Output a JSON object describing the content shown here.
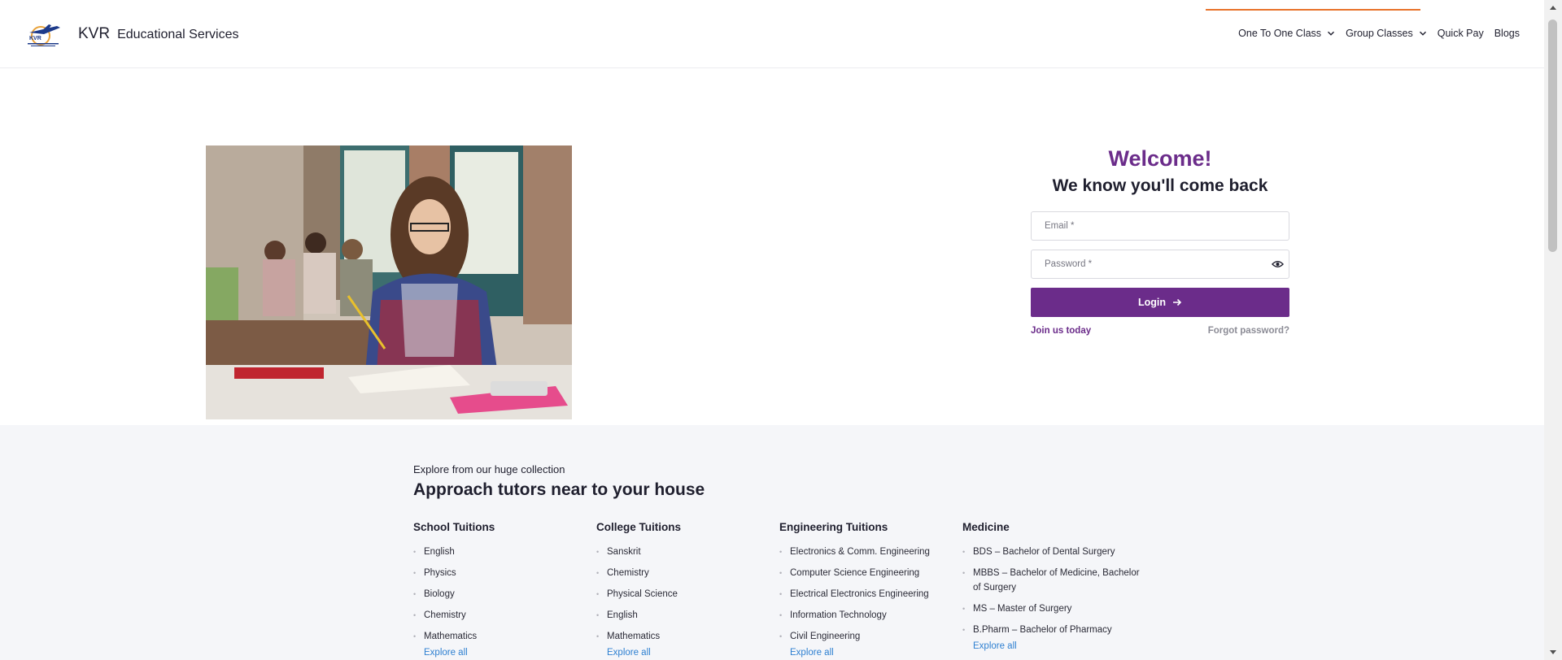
{
  "header": {
    "brand_name": "KVR",
    "brand_sub": "Educational Services",
    "nav": [
      {
        "label": "One To One Class",
        "dropdown": true
      },
      {
        "label": "Group Classes",
        "dropdown": true
      },
      {
        "label": "Quick Pay",
        "dropdown": false
      },
      {
        "label": "Blogs",
        "dropdown": false
      }
    ]
  },
  "login": {
    "welcome": "Welcome!",
    "tagline": "We know you'll come back",
    "email_placeholder": "Email *",
    "password_placeholder": "Password *",
    "login_label": "Login",
    "join_label": "Join us today",
    "forgot_label": "Forgot password?"
  },
  "explore": {
    "subtitle": "Explore from our huge collection",
    "title": "Approach tutors near to your house",
    "explore_all": "Explore all",
    "columns": [
      {
        "title": "School Tuitions",
        "items": [
          "English",
          "Physics",
          "Biology",
          "Chemistry",
          "Mathematics"
        ]
      },
      {
        "title": "College Tuitions",
        "items": [
          "Sanskrit",
          "Chemistry",
          "Physical Science",
          "English",
          "Mathematics"
        ]
      },
      {
        "title": "Engineering Tuitions",
        "items": [
          "Electronics & Comm. Engineering",
          "Computer Science Engineering",
          "Electrical Electronics Engineering",
          "Information Technology",
          "Civil Engineering"
        ]
      },
      {
        "title": "Medicine",
        "items": [
          "BDS – Bachelor of Dental Surgery",
          "MBBS – Bachelor of Medicine, Bachelor of Surgery",
          "MS – Master of Surgery",
          "B.Pharm – Bachelor of Pharmacy"
        ]
      }
    ]
  },
  "colors": {
    "brand_purple": "#6b2c8a",
    "nav_accent": "#e8722a",
    "link_blue": "#2f80d1",
    "section_bg": "#f5f6f9"
  }
}
